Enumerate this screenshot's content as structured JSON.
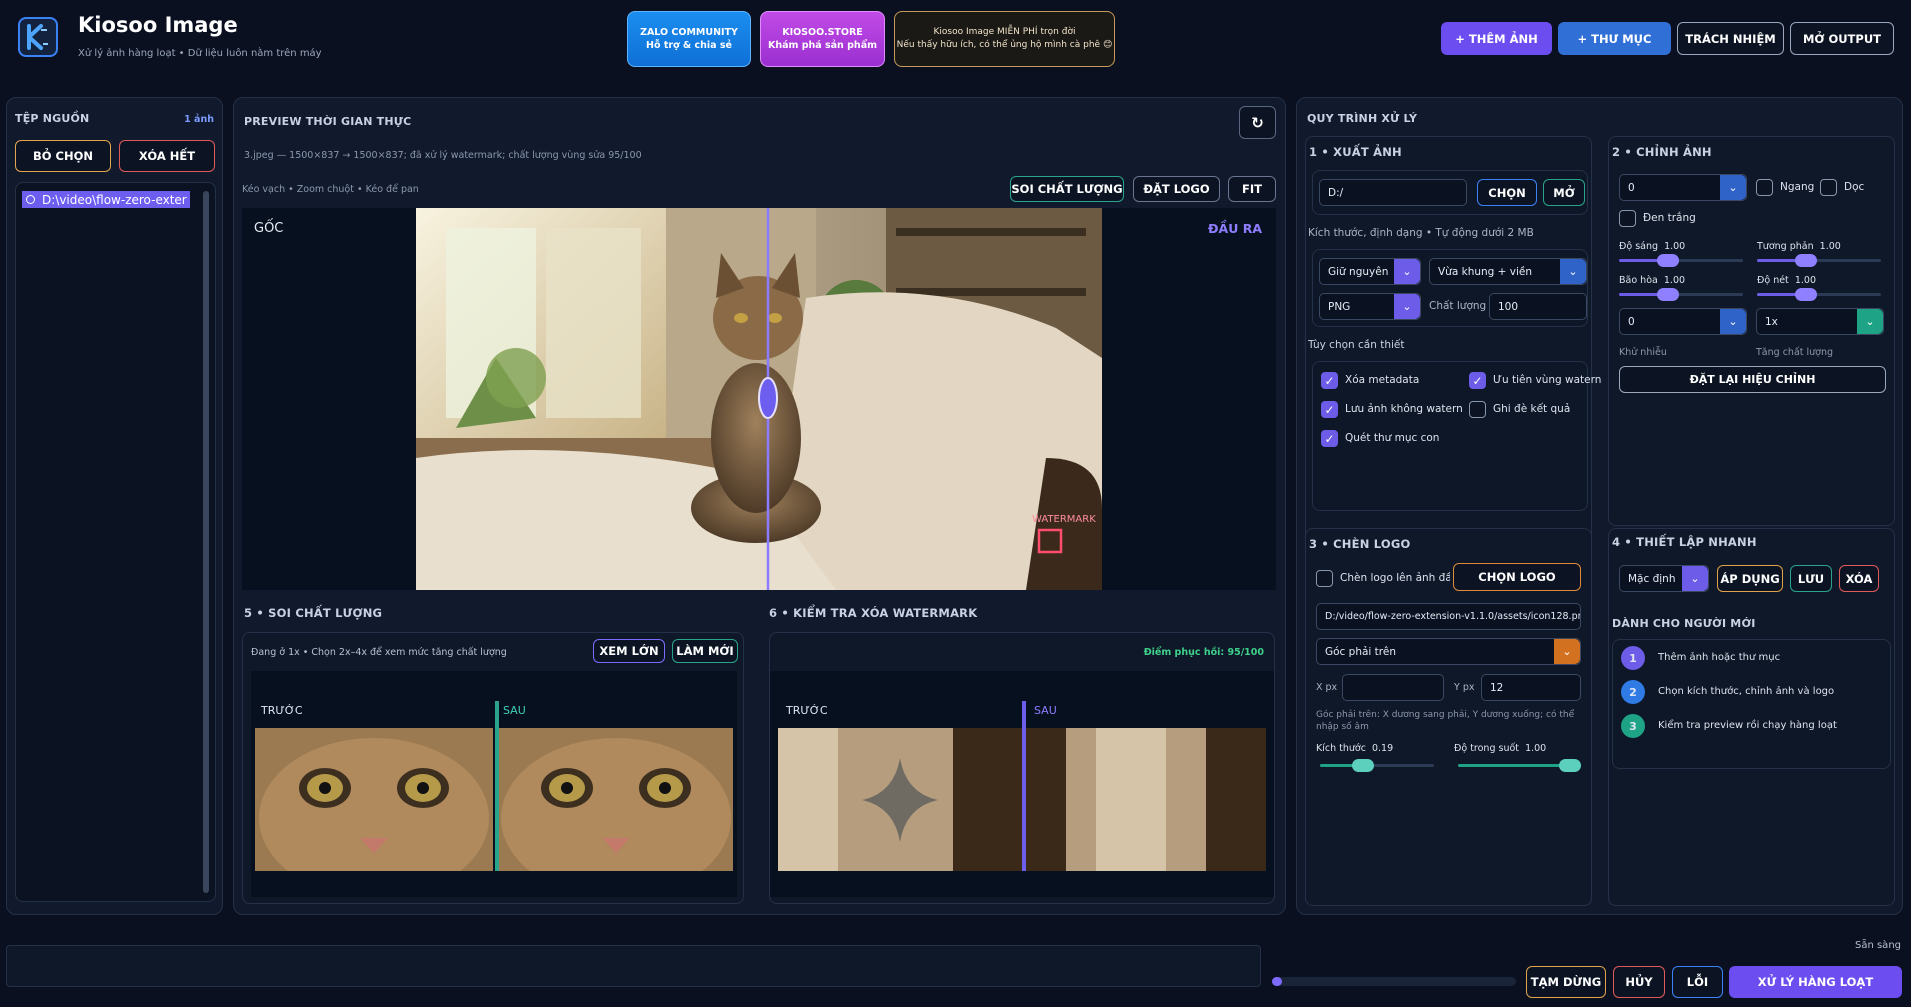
{
  "app": {
    "title": "Kiosoo Image",
    "subtitle": "Xử lý ảnh hàng loạt • Dữ liệu luôn nằm trên máy"
  },
  "promo": {
    "zalo_title": "ZALO COMMUNITY",
    "zalo_sub": "Hỗ trợ & chia sẻ",
    "store_title": "KIOSOO.STORE",
    "store_sub": "Khám phá sản phẩm",
    "free_title": "Kiosoo Image MIỄN PHÍ trọn đời",
    "free_sub": "Nếu thấy hữu ích, có thể ủng hộ mình cà phê 😊"
  },
  "top_actions": {
    "add_image": "+ THÊM ẢNH",
    "folder": "+ THƯ MỤC",
    "responsibility": "TRÁCH NHIỆM",
    "open_output": "MỞ OUTPUT"
  },
  "source": {
    "title": "TỆP NGUỒN",
    "count": "1 ảnh",
    "deselect": "BỎ CHỌN",
    "clear_all": "XÓA HẾT",
    "items": [
      "D:\\video\\flow-zero-exter"
    ]
  },
  "preview": {
    "title": "PREVIEW THỜI GIAN THỰC",
    "info": "3.jpeg — 1500×837 → 1500×837; đã xử lý watermark; chất lượng vùng sửa 95/100",
    "hint": "Kéo vạch • Zoom chuột • Kéo để pan",
    "btn_quality": "SOI CHẤT LƯỢNG",
    "btn_logo": "ĐẶT LOGO",
    "btn_fit": "FIT",
    "label_orig": "GỐC",
    "label_out": "ĐẦU RA",
    "watermark_label": "WATERMARK"
  },
  "quality": {
    "num": "5",
    "title": "SOI CHẤT LƯỢNG",
    "hint": "Đang ở 1x • Chọn 2x–4x để xem mức tăng chất lượng",
    "btn_big": "XEM LỚN",
    "btn_refresh": "LÀM MỚI",
    "before": "TRƯỚC",
    "after": "SAU"
  },
  "wm_check": {
    "num": "6",
    "title": "KIỂM TRA XÓA WATERMARK",
    "score": "Điểm phục hồi: 95/100",
    "before": "TRƯỚC",
    "after": "SAU"
  },
  "workflow": {
    "title": "QUY TRÌNH XỬ LÝ"
  },
  "export": {
    "num": "1",
    "title": "XUẤT ẢNH",
    "path": "D:/",
    "btn_choose": "CHỌN",
    "btn_open": "MỞ",
    "size_label": "Kích thước, định dạng • Tự động dưới 2 MB",
    "size_mode": "Giữ nguyên",
    "fit_mode": "Vừa khung + viền",
    "format": "PNG",
    "quality_label": "Chất lượng",
    "quality_value": "100",
    "options_title": "Tùy chọn cần thiết",
    "options": [
      {
        "label": "Xóa metadata",
        "checked": true
      },
      {
        "label": "Ưu tiên vùng watern",
        "checked": true
      },
      {
        "label": "Lưu ảnh không watern",
        "checked": true
      },
      {
        "label": "Ghi đè kết quả",
        "checked": false
      },
      {
        "label": "Quét thư mục con",
        "checked": true
      }
    ]
  },
  "adjust": {
    "num": "2",
    "title": "CHỈNH ẢNH",
    "rotate": "0",
    "horizontal": "Ngang",
    "vertical": "Dọc",
    "bw": "Đen trắng",
    "brightness": {
      "label": "Độ sáng",
      "value": "1.00"
    },
    "contrast": {
      "label": "Tương phản",
      "value": "1.00"
    },
    "saturation": {
      "label": "Bão hòa",
      "value": "1.00"
    },
    "sharpness": {
      "label": "Độ nét",
      "value": "1.00"
    },
    "denoise_value": "0",
    "upscale_value": "1x",
    "denoise_label": "Khử nhiễu",
    "upscale_label": "Tăng chất lượng",
    "reset": "ĐẶT LẠI HIỆU CHỈNH"
  },
  "logo": {
    "num": "3",
    "title": "CHÈN LOGO",
    "insert_label": "Chèn logo lên ảnh đầu",
    "btn_choose": "CHỌN LOGO",
    "path": "D:/video/flow-zero-extension-v1.1.0/assets/icon128.pr",
    "position": "Góc phải trên",
    "x_label": "X px",
    "x_value": "",
    "y_label": "Y px",
    "y_value": "12",
    "note": "Góc phải trên: X dương sang phải, Y dương xuống; có thể nhập số âm",
    "size": {
      "label": "Kích thước",
      "value": "0.19",
      "level": 0.19
    },
    "opacity": {
      "label": "Độ trong suốt",
      "value": "1.00",
      "level": 1.0
    }
  },
  "quick": {
    "num": "4",
    "title": "THIẾT LẬP NHANH",
    "preset": "Mặc định",
    "btn_apply": "ÁP DỤNG",
    "btn_save": "LƯU",
    "btn_delete": "XÓA",
    "newbie_title": "DÀNH CHO NGƯỜI MỚI",
    "steps": [
      {
        "n": "1",
        "text": "Thêm ảnh hoặc thư mục",
        "color": "#6c5ce7"
      },
      {
        "n": "2",
        "text": "Chọn kích thước, chỉnh ảnh và logo",
        "color": "#2f7ae5"
      },
      {
        "n": "3",
        "text": "Kiểm tra preview rồi chạy hàng loạt",
        "color": "#1fa386"
      }
    ]
  },
  "bottom": {
    "status": "Sẵn sàng",
    "progress": 0.0,
    "btn_pause": "TẠM DỪNG",
    "btn_cancel": "HỦY",
    "btn_errors": "LỖI",
    "btn_run": "XỬ LÝ HÀNG LOẠT"
  }
}
